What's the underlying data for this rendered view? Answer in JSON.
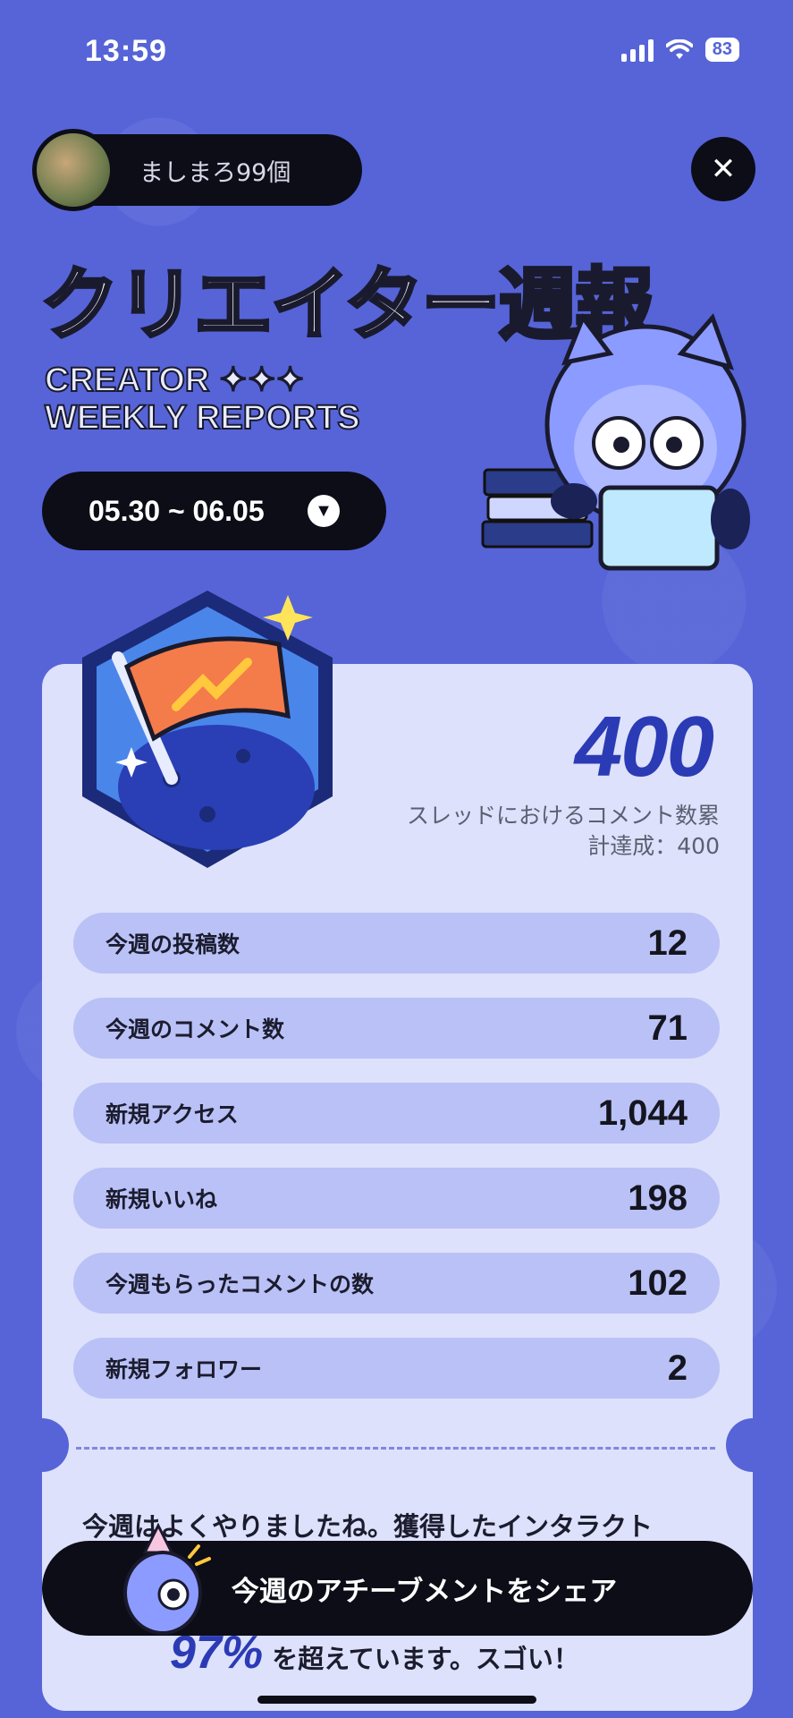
{
  "status_bar": {
    "time": "13:59",
    "battery": "83"
  },
  "profile": {
    "name": "ましまろ99個"
  },
  "header": {
    "title_part1": "クリエイター",
    "title_part2": "週報",
    "subtitle_line1": "CREATOR ✦✦✦",
    "subtitle_line2": "WEEKLY REPORTS"
  },
  "date_range": {
    "label": "05.30 ~ 06.05"
  },
  "achievement": {
    "value": "400",
    "caption_line1": "スレッドにおけるコメント数累",
    "caption_line2": "計達成：400"
  },
  "stats": [
    {
      "label": "今週の投稿数",
      "value": "12"
    },
    {
      "label": "今週のコメント数",
      "value": "71"
    },
    {
      "label": "新規アクセス",
      "value": "1,044"
    },
    {
      "label": "新規いいね",
      "value": "198"
    },
    {
      "label": "今週もらったコメントの数",
      "value": "102"
    },
    {
      "label": "新規フォロワー",
      "value": "2"
    }
  ],
  "summary": {
    "line1": "今週はよくやりましたね。獲得したインタラクト",
    "percent": "97%",
    "line2": "を超えています。スゴい！"
  },
  "share_button": {
    "label": "今週のアチーブメントをシェア"
  },
  "colors": {
    "background": "#5664d8",
    "card": "#dde1fb",
    "accent": "#2b3bb5",
    "title_accent": "#b6f07a"
  }
}
